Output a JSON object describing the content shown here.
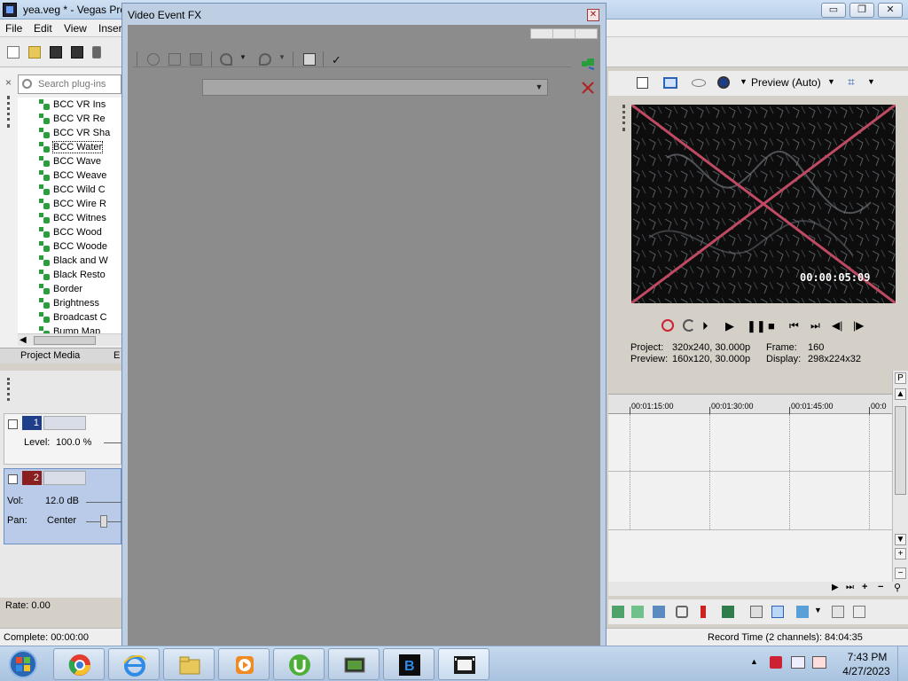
{
  "app": {
    "title": "yea.veg * - Vegas Pro",
    "window_controls": {
      "minimize": "▭",
      "maximize": "❐",
      "close": "✕"
    }
  },
  "menu": [
    "File",
    "Edit",
    "View",
    "Insert"
  ],
  "plugin_explorer": {
    "search_placeholder": "Search plug-ins",
    "close_glyph": "×",
    "items": [
      {
        "label": "BCC VR Ins"
      },
      {
        "label": "BCC VR Re"
      },
      {
        "label": "BCC VR Sha"
      },
      {
        "label": "BCC Water",
        "selected": true
      },
      {
        "label": "BCC Wave"
      },
      {
        "label": "BCC Weave"
      },
      {
        "label": "BCC Wild C"
      },
      {
        "label": "BCC Wire R"
      },
      {
        "label": "BCC Witnes"
      },
      {
        "label": "BCC Wood"
      },
      {
        "label": "BCC Woode"
      },
      {
        "label": "Black and W"
      },
      {
        "label": "Black Resto"
      },
      {
        "label": "Border"
      },
      {
        "label": "Brightness"
      },
      {
        "label": "Broadcast C"
      },
      {
        "label": "Bump Map"
      }
    ],
    "tabs": [
      "Project Media",
      "E"
    ]
  },
  "tracks": {
    "video": {
      "number": "1",
      "level_label": "Level:",
      "level_value": "100.0 %"
    },
    "audio": {
      "number": "2",
      "vol_label": "Vol:",
      "vol_value": "12.0 dB",
      "pan_label": "Pan:",
      "pan_value": "Center"
    },
    "rate": "Rate: 0.00"
  },
  "status": {
    "left": "Complete: 00:00:00",
    "right": "Record Time (2 channels): 84:04:35"
  },
  "preview": {
    "quality": "Preview (Auto)",
    "timecode": "00:00:05:09",
    "info": {
      "project_label": "Project:",
      "project_value": "320x240, 30.000p",
      "frame_label": "Frame:",
      "frame_value": "160",
      "preview_label": "Preview:",
      "preview_value": "160x120, 30.000p",
      "display_label": "Display:",
      "display_value": "298x224x32"
    }
  },
  "timeline": {
    "ruler_labels": [
      "00:01:15:00",
      "00:01:30:00",
      "00:01:45:00",
      "00:0"
    ]
  },
  "fx_dialog": {
    "title": "Video Event FX",
    "close_glyph": "✕",
    "dropdown_arrow": "▼"
  },
  "taskbar": {
    "time": "7:43 PM",
    "date": "4/27/2023"
  },
  "colors": {
    "dialog_body": "#8c8c8c",
    "preview_cross": "#c04a63",
    "video_track": "#1f3f8a",
    "audio_track": "#8a1f1f"
  }
}
